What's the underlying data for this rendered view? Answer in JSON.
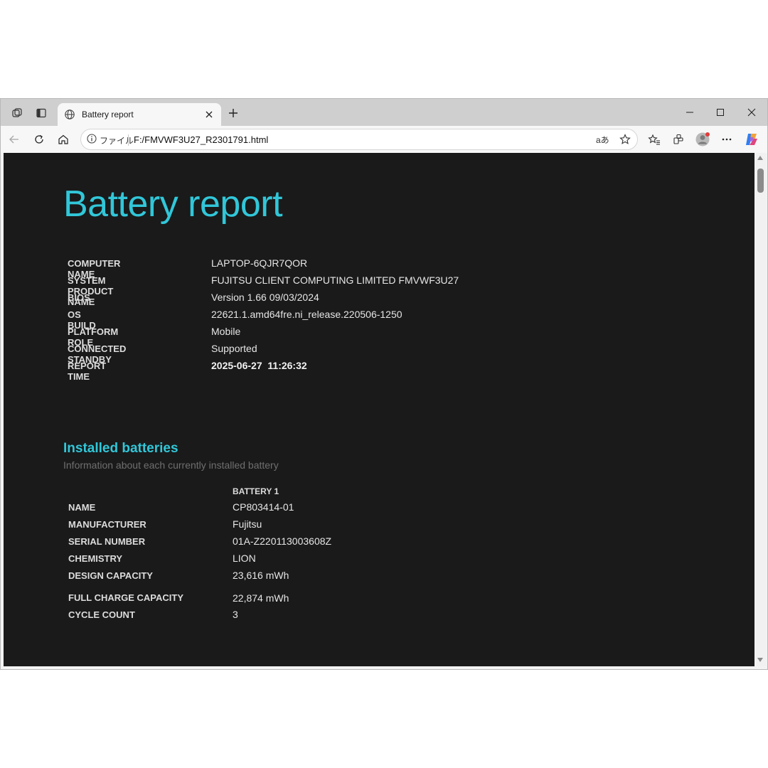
{
  "browser": {
    "tab_title": "Battery report",
    "site_info_label": "ファイル",
    "url": "F:/FMVWF3U27_R2301791.html",
    "read_aloud_label": "aあ"
  },
  "report": {
    "title": "Battery report",
    "system_info": [
      {
        "key": "COMPUTER NAME",
        "value": "LAPTOP-6QJR7QOR"
      },
      {
        "key": "SYSTEM PRODUCT NAME",
        "value": "FUJITSU CLIENT COMPUTING LIMITED FMVWF3U27"
      },
      {
        "key": "BIOS",
        "value": "Version 1.66 09/03/2024"
      },
      {
        "key": "OS BUILD",
        "value": "22621.1.amd64fre.ni_release.220506-1250"
      },
      {
        "key": "PLATFORM ROLE",
        "value": "Mobile"
      },
      {
        "key": "CONNECTED STANDBY",
        "value": "Supported"
      },
      {
        "key": "REPORT TIME",
        "value": "2025-06-27  11:26:32"
      }
    ],
    "installed_batteries": {
      "title": "Installed batteries",
      "subtitle": "Information about each currently installed battery",
      "column_header": "BATTERY 1",
      "rows": [
        {
          "key": "NAME",
          "value": "CP803414-01"
        },
        {
          "key": "MANUFACTURER",
          "value": "Fujitsu"
        },
        {
          "key": "SERIAL NUMBER",
          "value": "01A-Z220113003608Z"
        },
        {
          "key": "CHEMISTRY",
          "value": "LION"
        },
        {
          "key": "DESIGN CAPACITY",
          "value": "23,616 mWh"
        },
        {
          "key": "FULL CHARGE CAPACITY",
          "value": "22,874 mWh"
        },
        {
          "key": "CYCLE COUNT",
          "value": "3"
        }
      ]
    }
  },
  "colors": {
    "accent": "#31c7d9",
    "content_background": "#1a1a1a"
  },
  "icons": [
    "workspaces-icon",
    "vertical-tabs-icon",
    "globe-icon",
    "close-icon",
    "plus-icon",
    "minimize-icon",
    "maximize-icon",
    "back-icon",
    "refresh-icon",
    "home-icon",
    "info-icon",
    "star-icon",
    "favorites-icon",
    "extensions-icon",
    "avatar",
    "more-icon",
    "copilot-icon"
  ]
}
